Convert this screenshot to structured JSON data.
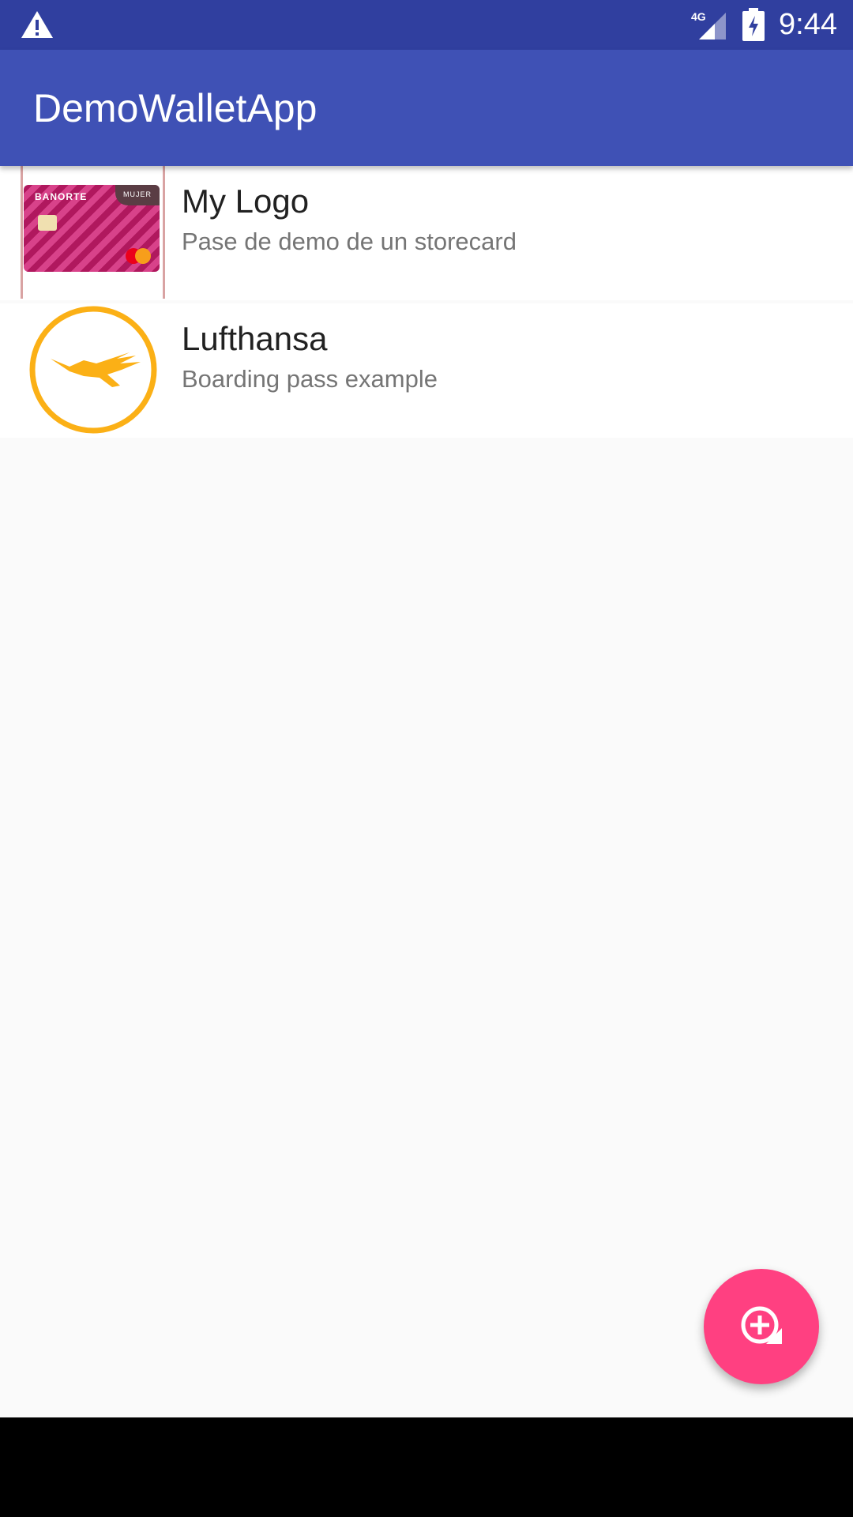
{
  "status_bar": {
    "time": "9:44",
    "network_label": "4G",
    "icons": [
      "warning-icon",
      "signal-icon",
      "battery-charging-icon"
    ]
  },
  "app_bar": {
    "title": "DemoWalletApp"
  },
  "passes": [
    {
      "name": "My Logo",
      "description": "Pase de demo de un storecard",
      "thumbnail": "storecard-thumbnail",
      "card_brand": "BANORTE",
      "card_tag": "MUJER"
    },
    {
      "name": "Lufthansa",
      "description": "Boarding pass example",
      "thumbnail": "lufthansa-logo-icon"
    }
  ],
  "fab": {
    "icon": "add-pass-icon"
  },
  "nav_bar": {
    "icons": [
      "back-icon",
      "home-icon",
      "recents-icon"
    ]
  },
  "colors": {
    "status_bar": "#303f9f",
    "primary": "#3f51b5",
    "accent": "#ff4081",
    "lufthansa_yellow": "#fbb016"
  }
}
